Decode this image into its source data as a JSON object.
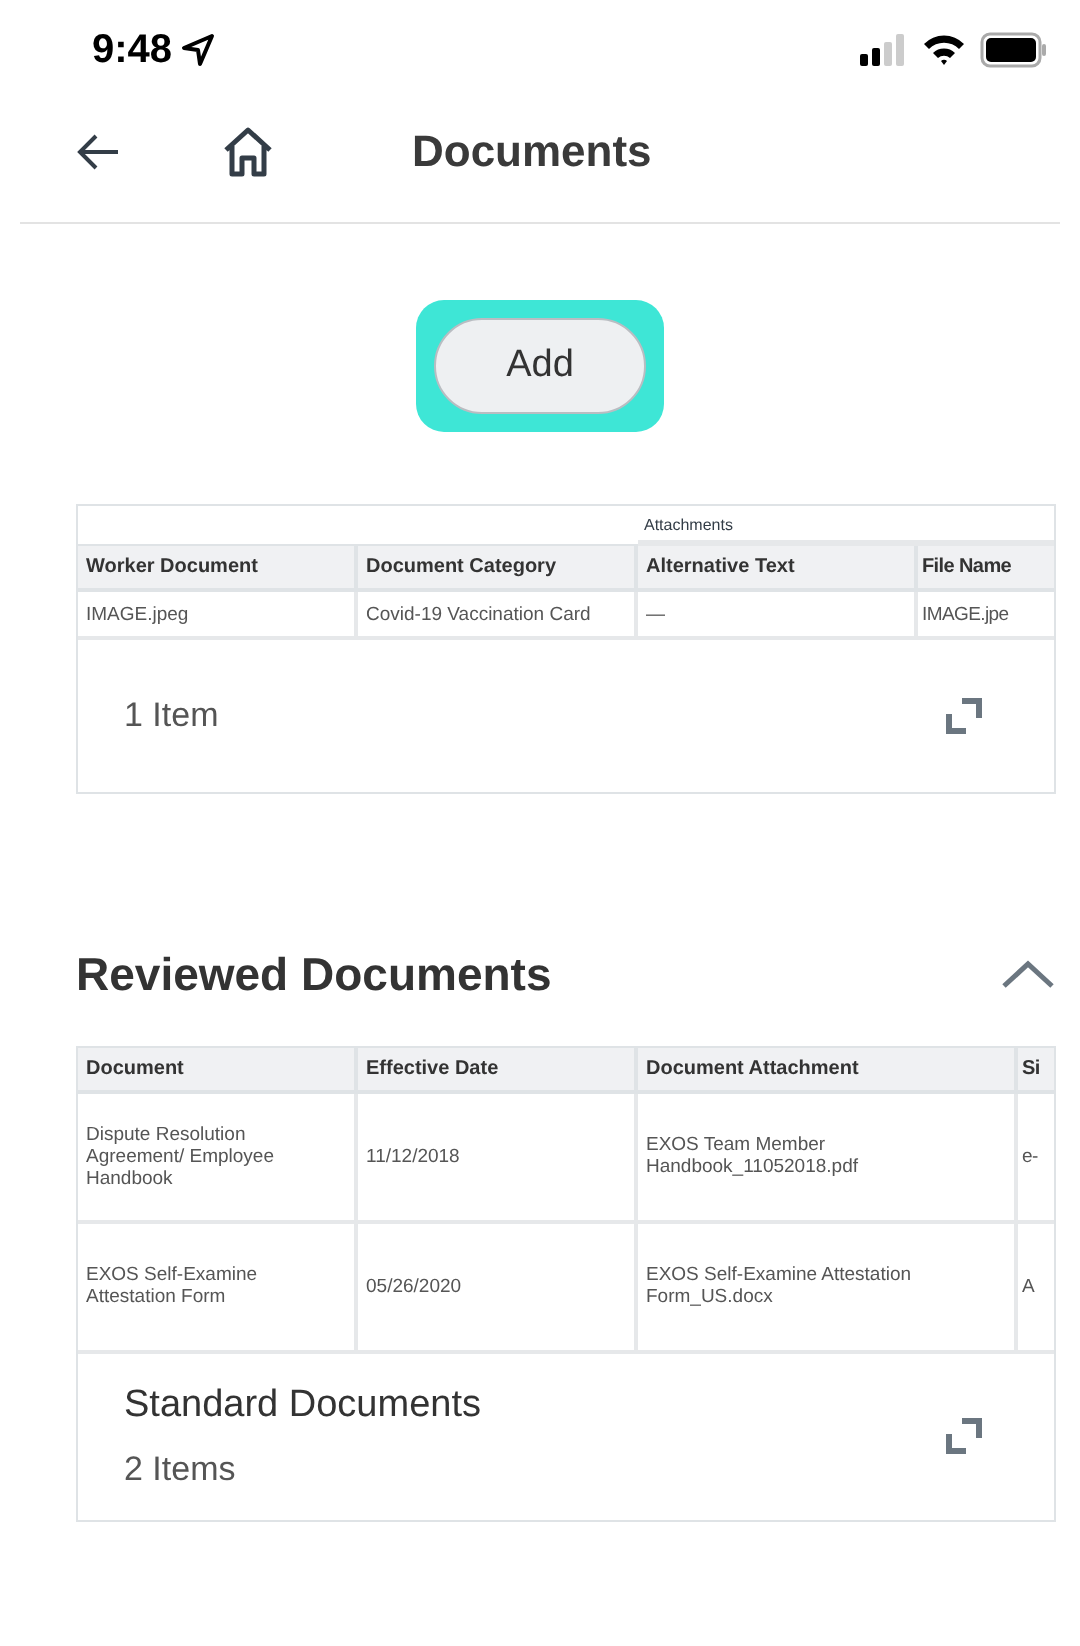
{
  "status_bar": {
    "time": "9:48"
  },
  "nav": {
    "title": "Documents"
  },
  "add_button": {
    "label": "Add",
    "focused": true
  },
  "worker_documents": {
    "group_header": "Attachments",
    "columns": [
      "Worker Document",
      "Document Category",
      "Alternative Text",
      "File Name"
    ],
    "rows": [
      [
        "IMAGE.jpeg",
        "Covid-19 Vaccination Card",
        "—",
        "IMAGE.jpe"
      ]
    ],
    "footer": {
      "count": "1 Item"
    }
  },
  "reviewed_documents": {
    "title": "Reviewed Documents",
    "expanded": true,
    "columns": [
      "Document",
      "Effective Date",
      "Document Attachment",
      "Si"
    ],
    "rows": [
      [
        "Dispute Resolution Agreement/ Employee Handbook",
        "11/12/2018",
        "EXOS Team Member Handbook_11052018.pdf",
        "e-"
      ],
      [
        "EXOS Self-Examine Attestation Form",
        "05/26/2020",
        "EXOS Self-Examine Attestation Form_US.docx",
        "A"
      ]
    ],
    "footer": {
      "title": "Standard Documents",
      "count": "2 Items"
    }
  }
}
